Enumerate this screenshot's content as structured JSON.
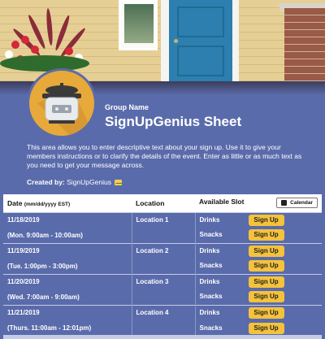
{
  "header": {
    "group_label": "Group Name",
    "title": "SignUpGenius Sheet",
    "description": "This area allows you to enter descriptive text about your sign up. Use it to give your members instructions or to clarify the details of the event. Enter as little or as much text as you need to get your message across.",
    "created_by_label": "Created by:",
    "created_by_name": "SignUpGenius"
  },
  "table": {
    "col_date": "Date",
    "col_date_format": "(mm/dd/yyyy EST)",
    "col_location": "Location",
    "col_slot": "Available Slot",
    "calendar_label": "Calendar",
    "rows": [
      {
        "date": "11/18/2019",
        "time": "(Mon. 9:00am - 10:00am)",
        "location": "Location 1",
        "slots": [
          "Drinks",
          "Snacks"
        ]
      },
      {
        "date": "11/19/2019",
        "time": "(Tue. 1:00pm - 3:00pm)",
        "location": "Location 2",
        "slots": [
          "Drinks",
          "Snacks"
        ]
      },
      {
        "date": "11/20/2019",
        "time": "(Wed. 7:00am - 9:00am)",
        "location": "Location 3",
        "slots": [
          "Drinks",
          "Snacks"
        ]
      },
      {
        "date": "11/21/2019",
        "time": "(Thurs. 11:00am - 12:01pm)",
        "location": "Location 4",
        "slots": [
          "Drinks",
          "Snacks"
        ]
      }
    ],
    "signup_label": "Sign Up"
  },
  "colors": {
    "background": "#5a6bab",
    "accent": "#f4c23b",
    "badge": "#e7a93a"
  },
  "icons": [
    "slow-cooker-icon",
    "mail-icon",
    "calendar-icon"
  ]
}
